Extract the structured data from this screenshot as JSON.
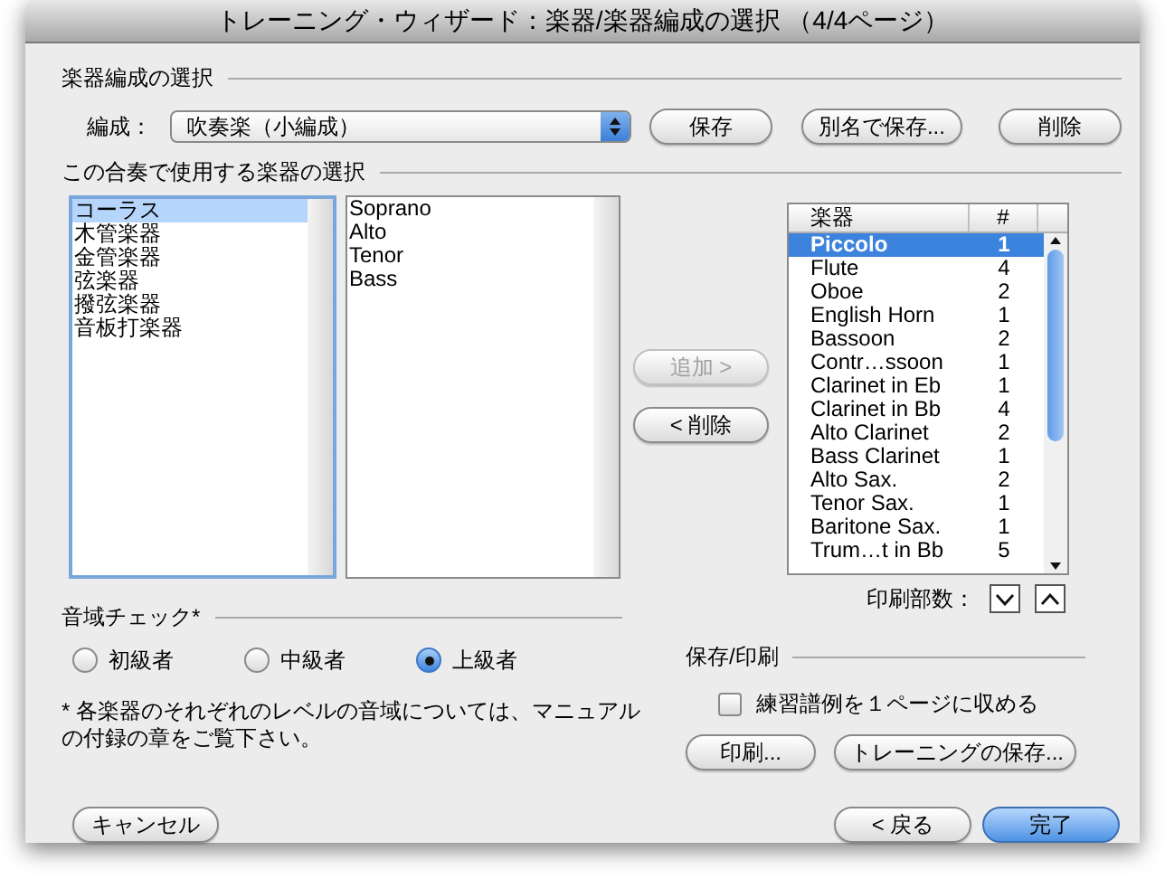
{
  "window": {
    "title": "トレーニング・ウィザード：楽器/楽器編成の選択 （4/4ページ）"
  },
  "ensemble": {
    "heading": "楽器編成の選択",
    "label": "編成：",
    "value": "吹奏楽（小編成）",
    "buttons": [
      "保存",
      "別名で保存...",
      "削除"
    ]
  },
  "instruments": {
    "heading": "この合奏で使用する楽器の選択",
    "families": [
      {
        "label": "コーラス",
        "selected": true
      },
      {
        "label": "木管楽器",
        "selected": false
      },
      {
        "label": "金管楽器",
        "selected": false
      },
      {
        "label": "弦楽器",
        "selected": false
      },
      {
        "label": "撥弦楽器",
        "selected": false
      },
      {
        "label": "音板打楽器",
        "selected": false
      }
    ],
    "choices": [
      "Soprano",
      "Alto",
      "Tenor",
      "Bass"
    ],
    "add_button": {
      "label": "追加 >",
      "disabled": true
    },
    "remove_button": {
      "label": "< 削除",
      "disabled": false
    },
    "table": {
      "columns": [
        "楽器",
        "#"
      ],
      "rows": [
        {
          "name": "Piccolo",
          "count": "1",
          "selected": true
        },
        {
          "name": "Flute",
          "count": "4",
          "selected": false
        },
        {
          "name": "Oboe",
          "count": "2",
          "selected": false
        },
        {
          "name": "English Horn",
          "count": "1",
          "selected": false
        },
        {
          "name": "Bassoon",
          "count": "2",
          "selected": false
        },
        {
          "name": "Contr…ssoon",
          "count": "1",
          "selected": false
        },
        {
          "name": "Clarinet in Eb",
          "count": "1",
          "selected": false
        },
        {
          "name": "Clarinet in Bb",
          "count": "4",
          "selected": false
        },
        {
          "name": "Alto Clarinet",
          "count": "2",
          "selected": false
        },
        {
          "name": "Bass Clarinet",
          "count": "1",
          "selected": false
        },
        {
          "name": "Alto Sax.",
          "count": "2",
          "selected": false
        },
        {
          "name": "Tenor Sax.",
          "count": "1",
          "selected": false
        },
        {
          "name": "Baritone Sax.",
          "count": "1",
          "selected": false
        },
        {
          "name": "Trum…t in Bb",
          "count": "5",
          "selected": false
        }
      ]
    },
    "copies_label": "印刷部数："
  },
  "range_check": {
    "heading": "音域チェック*",
    "levels": [
      {
        "label": "初級者",
        "selected": false
      },
      {
        "label": "中級者",
        "selected": false
      },
      {
        "label": "上級者",
        "selected": true
      }
    ],
    "note": "* 各楽器のそれぞれのレベルの音域については、マニュアルの付録の章をご覧下さい。"
  },
  "save_print": {
    "heading": "保存/印刷",
    "fit_checkbox": {
      "label": "練習譜例を１ページに収める",
      "checked": false
    },
    "buttons": [
      "印刷...",
      "トレーニングの保存..."
    ]
  },
  "footer": {
    "cancel": "キャンセル",
    "back": "< 戻る",
    "finish": "完了"
  }
}
